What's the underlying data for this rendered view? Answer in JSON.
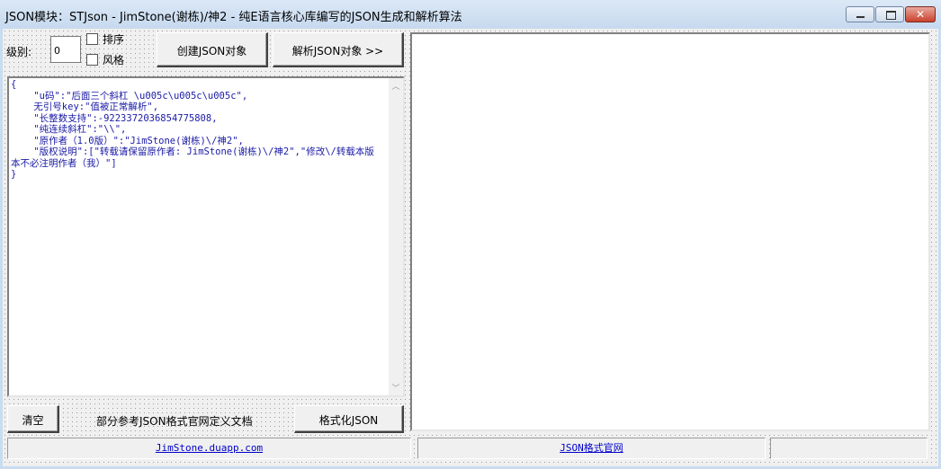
{
  "window": {
    "title": "JSON模块：STJson - JimStone(谢栋)/神2 - 纯E语言核心库编写的JSON生成和解析算法",
    "minimize_glyph": "",
    "close_glyph": "✕"
  },
  "toolbar": {
    "level_label": "级别:",
    "level_value": "0",
    "sort_label": "排序",
    "style_label": "风格",
    "create_button": "创建JSON对象",
    "parse_button": "解析JSON对象 >>"
  },
  "editor": {
    "content": "{\n    \"u码\":\"后面三个斜杠 \\u005c\\u005c\\u005c\",\n    无引号key:\"值被正常解析\",\n    \"长整数支持\":-9223372036854775808,\n    \"纯连续斜杠\":\"\\\\\",\n    \"原作者（1.0版）\":\"JimStone(谢栋)\\/神2\",\n    \"版权说明\":[\"转载请保留原作者: JimStone(谢栋)\\/神2\",\"修改\\/转载本版本不必注明作者（我）\"]\n}"
  },
  "bottom_bar": {
    "clear_button": "清空",
    "docs_label": "部分参考JSON格式官网定义文档",
    "format_button": "格式化JSON"
  },
  "status_bar": {
    "left_link": "JimStone.duapp.com",
    "mid_link": "JSON格式官网",
    "right_text": ""
  }
}
